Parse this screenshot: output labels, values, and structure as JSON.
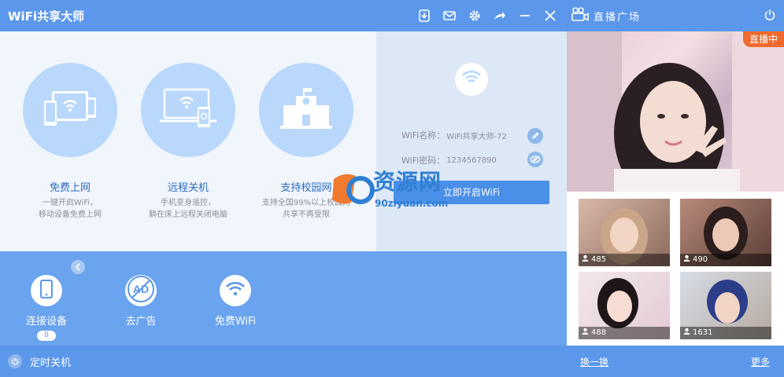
{
  "app": {
    "title": "WiFi共享大师"
  },
  "live": {
    "header_title": "直播广场",
    "hero_badge": "直播中",
    "thumbs": [
      {
        "count": "485"
      },
      {
        "count": "490"
      },
      {
        "count": "488"
      },
      {
        "count": "1631"
      }
    ],
    "refresh_label": "换一换",
    "more_label": "更多"
  },
  "features": [
    {
      "title": "免费上网",
      "desc1": "一键开启WiFi，",
      "desc2": "移动设备免费上网"
    },
    {
      "title": "远程关机",
      "desc1": "手机变身遥控，",
      "desc2": "躺在床上远程关闭电脑"
    },
    {
      "title": "支持校园网",
      "desc1": "支持全国99%以上校园网",
      "desc2": "共享不再受限"
    }
  ],
  "wifi": {
    "name_label": "WiFi名称：",
    "name_value": "WiFi共享大师-72",
    "pwd_label": "WiFi密码：",
    "pwd_value": "1234567890",
    "start_label": "立即开启WiFi"
  },
  "watermark": {
    "main": "资源网",
    "sub": "90ziyuan.com"
  },
  "tools": [
    {
      "label": "连接设备",
      "badge": "0"
    },
    {
      "label": "去广告"
    },
    {
      "label": "免费WiFi"
    }
  ],
  "bottom": {
    "timer_label": "定时关机"
  },
  "colors": {
    "primary": "#5b97ea",
    "accent": "#f06a2d",
    "light": "#b9d8fb"
  }
}
